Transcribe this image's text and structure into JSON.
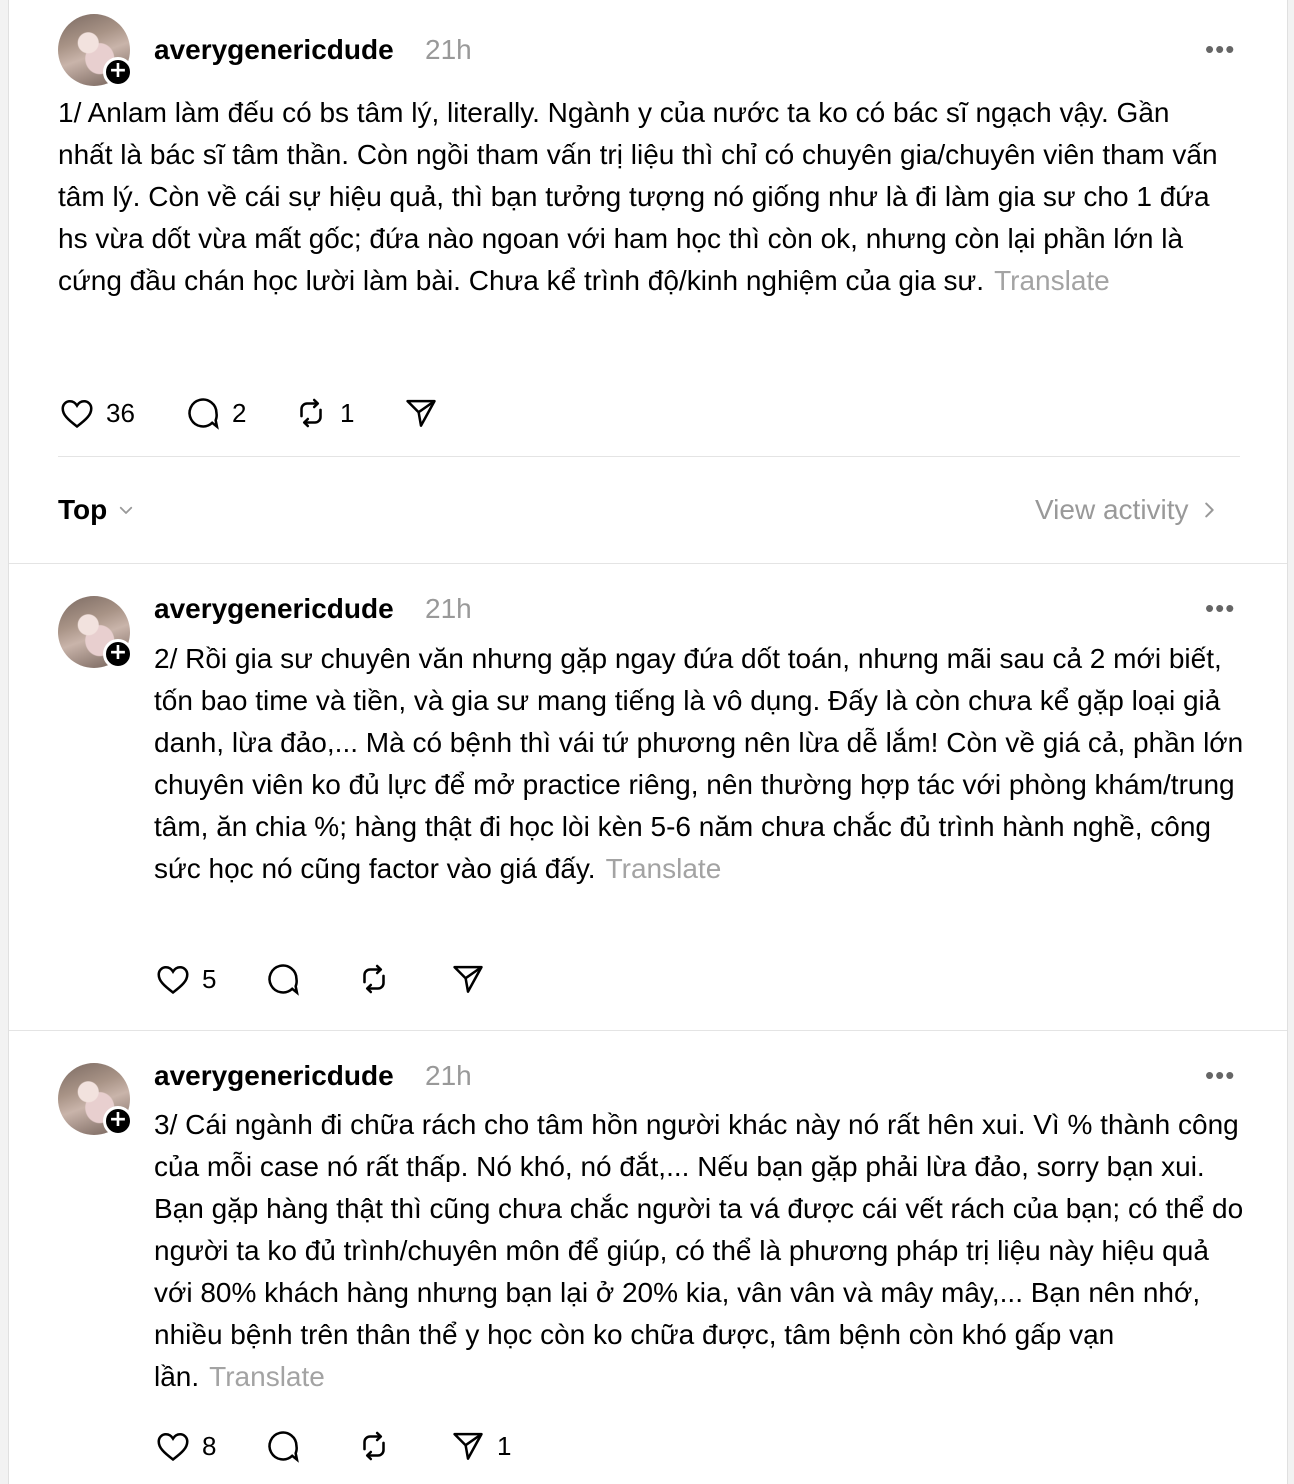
{
  "posts": [
    {
      "username": "averygenericdude",
      "time": "21h",
      "text": "1/ Anlam làm đếu có bs tâm lý, literally. Ngành y của nước ta ko có bác sĩ ngạch vậy. Gần nhất là bác sĩ tâm thần. Còn ngồi tham vấn trị liệu thì chỉ có chuyên gia/chuyên viên tham vấn tâm lý. Còn về cái sự hiệu quả, thì bạn tưởng tượng nó giống như là đi làm gia sư cho 1 đứa hs vừa dốt vừa mất gốc; đứa nào ngoan với ham học thì còn ok, nhưng còn lại phần lớn là cứng đầu chán học lười làm bài. Chưa kể trình độ/kinh nghiệm của gia sư.",
      "translate": "Translate",
      "likes": "36",
      "replies": "2",
      "reposts": "1",
      "shares": ""
    },
    {
      "username": "averygenericdude",
      "time": "21h",
      "text": "2/ Rồi gia sư chuyên văn nhưng gặp ngay đứa dốt toán, nhưng mãi sau cả 2 mới biết, tốn bao time và tiền, và gia sư mang tiếng là vô dụng. Đấy là còn chưa kể gặp loại giả danh, lừa đảo,... Mà có bệnh thì vái tứ phương nên lừa dễ lắm! Còn về giá cả, phần lớn chuyên viên ko đủ lực để mở practice riêng, nên thường hợp tác với phòng khám/trung tâm, ăn chia %; hàng thật đi học lòi kèn 5-6 năm chưa chắc đủ trình hành nghề, công sức học nó cũng factor vào giá đấy.",
      "translate": "Translate",
      "likes": "5",
      "replies": "",
      "reposts": "",
      "shares": ""
    },
    {
      "username": "averygenericdude",
      "time": "21h",
      "text": "3/ Cái ngành đi chữa rách cho tâm hồn người khác này nó rất hên xui. Vì % thành công của mỗi case nó rất thấp. Nó khó, nó đắt,... Nếu bạn gặp phải lừa đảo, sorry bạn xui. Bạn gặp hàng thật thì cũng chưa chắc người ta vá được cái vết rách của bạn; có thể do người ta ko đủ trình/chuyên môn để giúp, có thể là phương pháp trị liệu này hiệu quả với 80% khách hàng nhưng bạn lại ở 20% kia, vân vân và mây mây,... Bạn nên nhớ, nhiều bệnh trên thân thể y học còn ko chữa được, tâm bệnh còn khó gấp vạn lần.",
      "translate": "Translate",
      "likes": "8",
      "replies": "",
      "reposts": "",
      "shares": "1"
    }
  ],
  "sort": {
    "label": "Top"
  },
  "view_activity": "View activity",
  "icons": {
    "like": "heart-icon",
    "reply": "comment-icon",
    "repost": "repost-icon",
    "share": "share-icon",
    "more": "more-icon",
    "follow": "plus-icon"
  }
}
